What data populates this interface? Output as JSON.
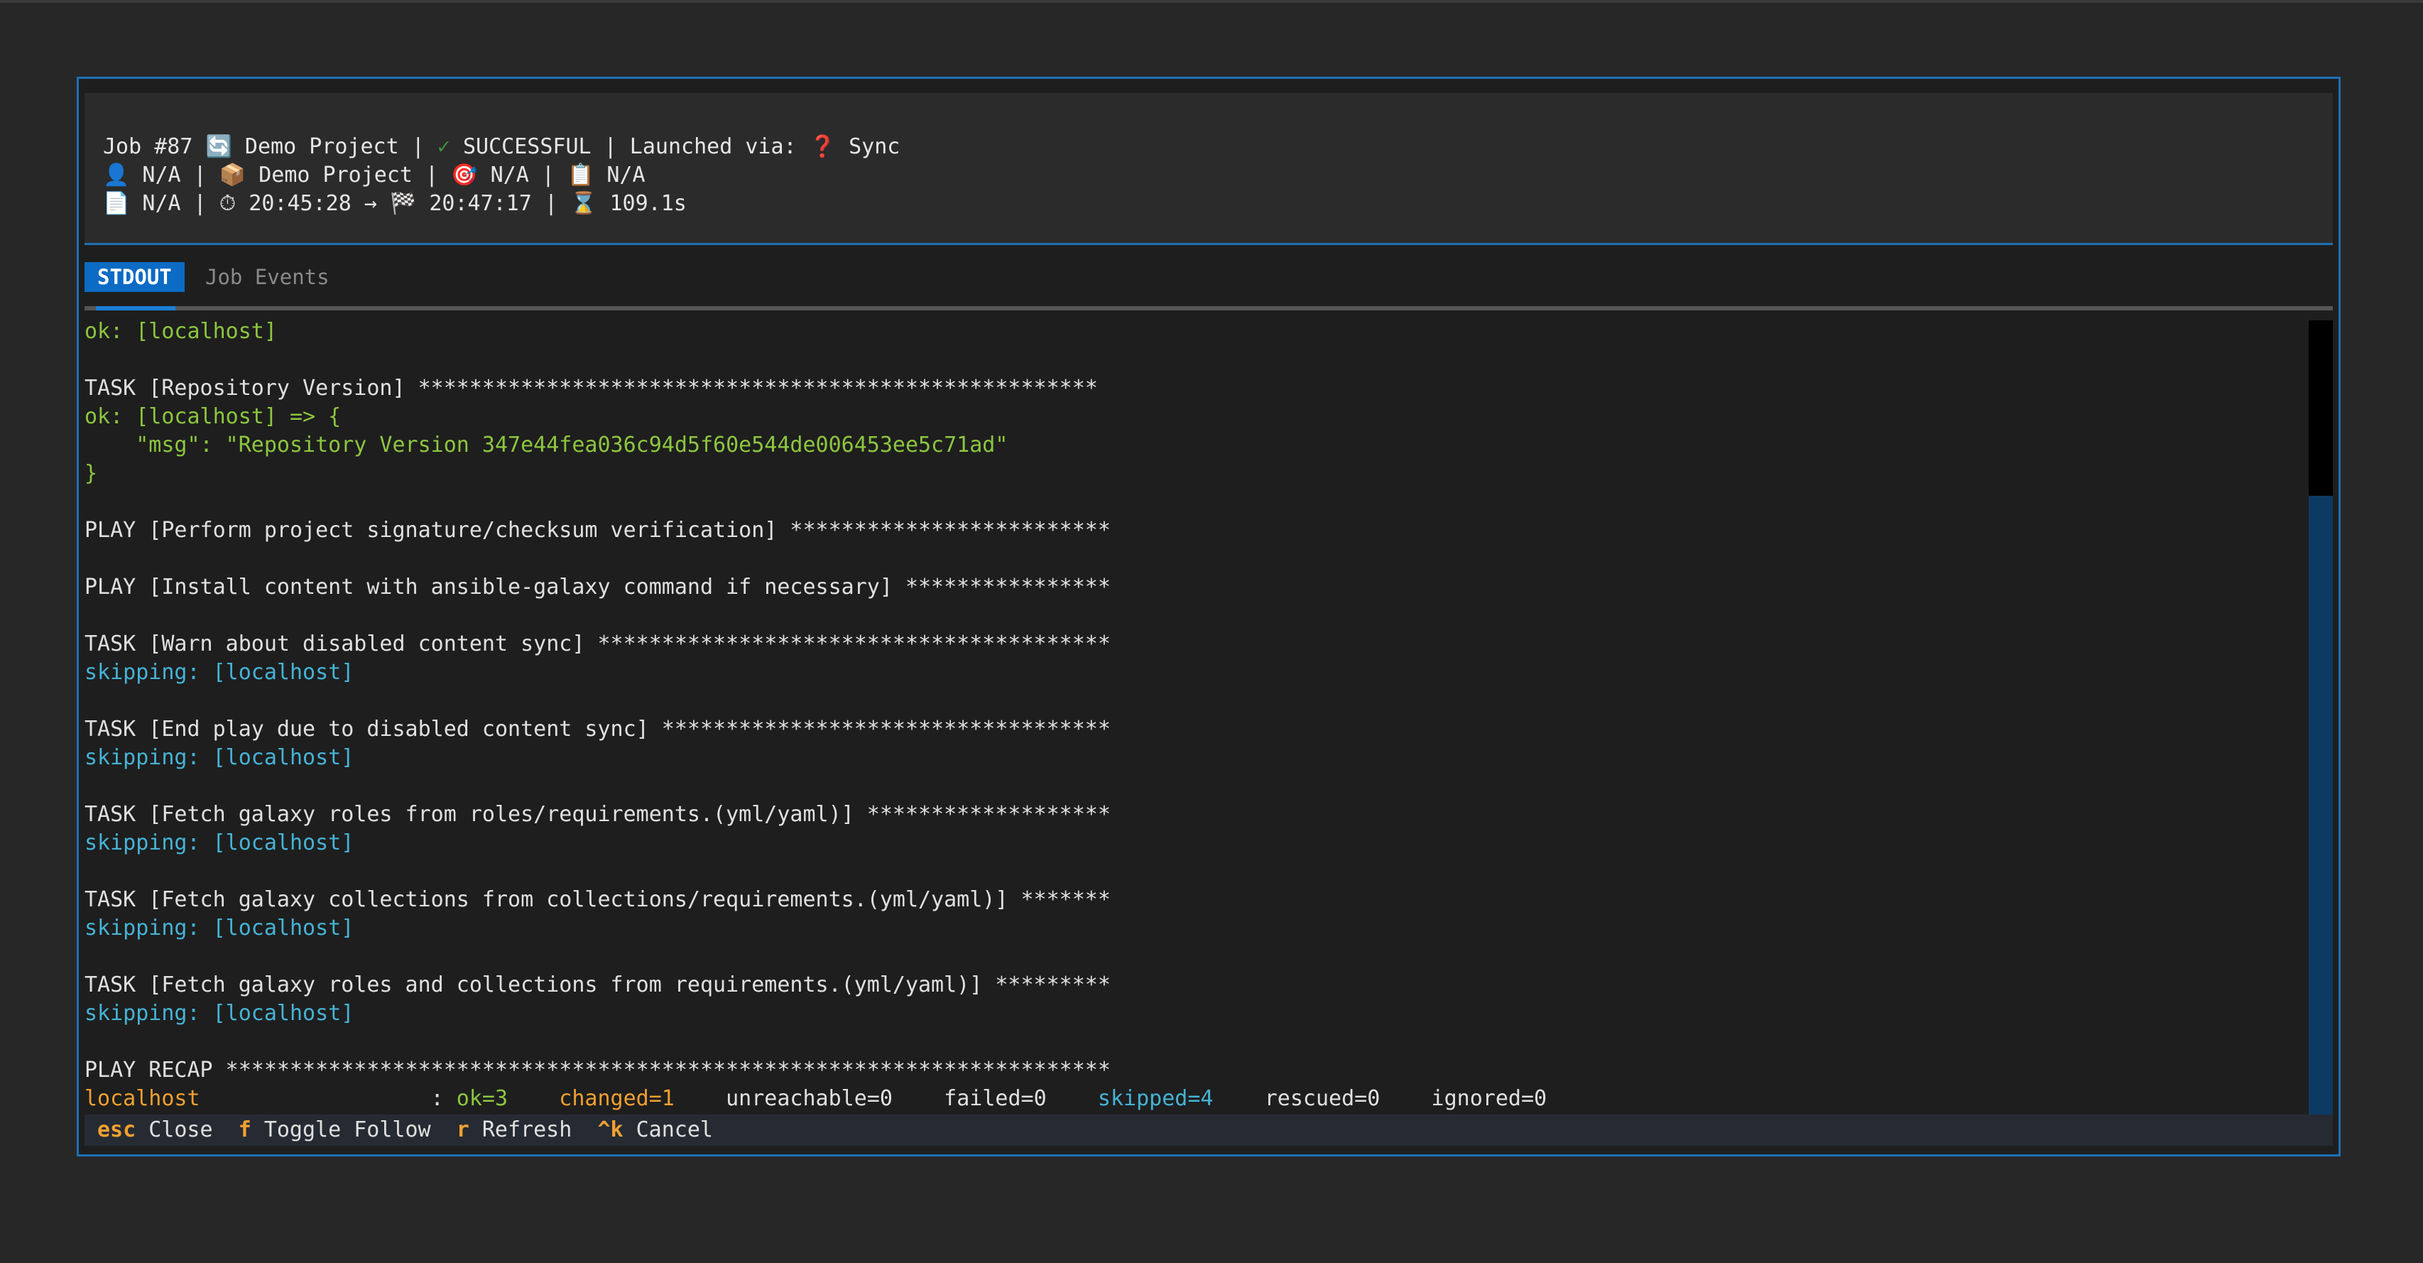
{
  "header": {
    "line1": {
      "job": "Job #87",
      "project_icon": "🔄",
      "project": "Demo Project",
      "sep": "|",
      "status_icon": "✓",
      "status": "SUCCESSFUL",
      "launched_label": "Launched via:",
      "launch_icon": "❓",
      "launch_type": "Sync"
    },
    "line2": {
      "user_icon": "👤",
      "user": "N/A",
      "inventory_icon": "📦",
      "inventory": "Demo Project",
      "target_icon": "🎯",
      "target": "N/A",
      "template_icon": "📋",
      "template": "N/A"
    },
    "line3": {
      "file_icon": "📄",
      "file": "N/A",
      "start_icon": "⏱",
      "start": "20:45:28",
      "arrow": "→",
      "finish_icon": "🏁",
      "finish": "20:47:17",
      "duration_icon": "⌛",
      "duration": "109.1s"
    }
  },
  "tabs": {
    "stdout": "STDOUT",
    "job_events": "Job Events"
  },
  "log": {
    "l01": "ok: [localhost]",
    "l02": "",
    "l03": "TASK [Repository Version] *****************************************************",
    "l04": "ok: [localhost] => {",
    "l05": "    \"msg\": \"Repository Version 347e44fea036c94d5f60e544de006453ee5c71ad\"",
    "l06": "}",
    "l07": "",
    "l08": "PLAY [Perform project signature/checksum verification] *************************",
    "l09": "",
    "l10": "PLAY [Install content with ansible-galaxy command if necessary] ****************",
    "l11": "",
    "l12": "TASK [Warn about disabled content sync] ****************************************",
    "l13": "skipping: [localhost]",
    "l14": "",
    "l15": "TASK [End play due to disabled content sync] ***********************************",
    "l16": "skipping: [localhost]",
    "l17": "",
    "l18": "TASK [Fetch galaxy roles from roles/requirements.(yml/yaml)] *******************",
    "l19": "skipping: [localhost]",
    "l20": "",
    "l21": "TASK [Fetch galaxy collections from collections/requirements.(yml/yaml)] *******",
    "l22": "skipping: [localhost]",
    "l23": "",
    "l24": "TASK [Fetch galaxy roles and collections from requirements.(yml/yaml)] *********",
    "l25": "skipping: [localhost]",
    "l26": "",
    "l27": "PLAY RECAP *********************************************************************",
    "recap": {
      "host": "localhost",
      "colon": ": ",
      "ok": "ok=3",
      "changed": "changed=1",
      "unreachable": "unreachable=0",
      "failed": "failed=0",
      "skipped": "skipped=4",
      "rescued": "rescued=0",
      "ignored": "ignored=0"
    }
  },
  "footer": {
    "close_key": "esc",
    "close_label": "Close",
    "follow_key": "f",
    "follow_label": "Toggle Follow",
    "refresh_key": "r",
    "refresh_label": "Refresh",
    "cancel_key": "^k",
    "cancel_label": "Cancel"
  },
  "scrollbar": {
    "position": 0.0,
    "thumb_fraction": 0.22
  },
  "colors": {
    "accent": "#1f6fb5",
    "ok": "#8cc63f",
    "skipping": "#45b3d6",
    "changed": "#f0a030"
  }
}
